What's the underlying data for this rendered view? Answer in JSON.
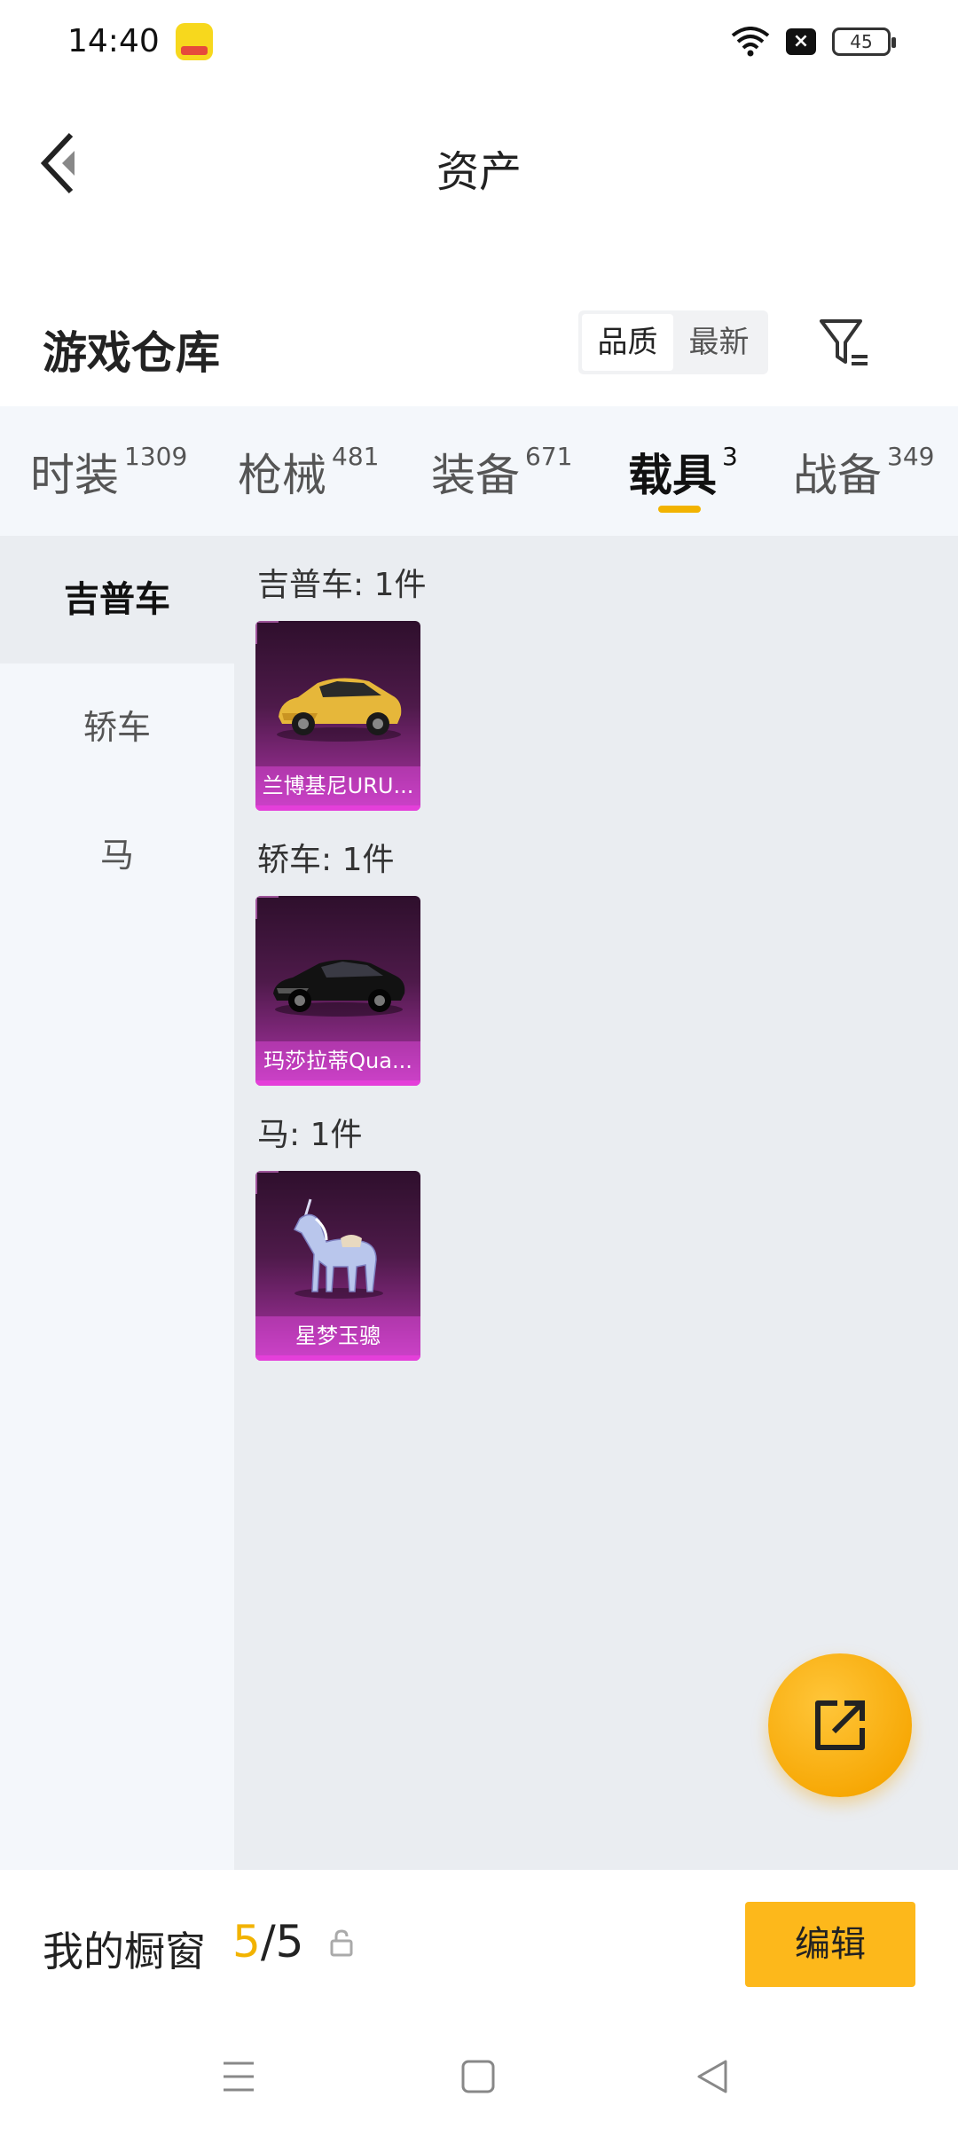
{
  "status_bar": {
    "time": "14:40",
    "battery": "45"
  },
  "header": {
    "title": "资产"
  },
  "warehouse": {
    "title": "游戏仓库",
    "sort_options": [
      "品质",
      "最新"
    ],
    "sort_selected": "品质"
  },
  "tabs": [
    {
      "label": "时装",
      "count": "1309"
    },
    {
      "label": "枪械",
      "count": "481"
    },
    {
      "label": "装备",
      "count": "671"
    },
    {
      "label": "载具",
      "count": "3",
      "active": true
    },
    {
      "label": "战备",
      "count": "349"
    }
  ],
  "side_categories": [
    {
      "label": "吉普车",
      "active": true
    },
    {
      "label": "轿车"
    },
    {
      "label": "马"
    }
  ],
  "sections": [
    {
      "label": "吉普车: 1件",
      "item_name": "兰博基尼URU...",
      "item_icon": "yellow-suv-icon"
    },
    {
      "label": "轿车: 1件",
      "item_name": "玛莎拉蒂Qua...",
      "item_icon": "black-sedan-icon"
    },
    {
      "label": "马: 1件",
      "item_name": "星梦玉骢",
      "item_icon": "unicorn-icon"
    }
  ],
  "showcase": {
    "label": "我的橱窗",
    "current": "5",
    "separator": "/",
    "total": "5",
    "edit_label": "编辑"
  },
  "colors": {
    "accent": "#f2b300",
    "button": "#fdb81b",
    "card_bg": "#4e1a4a"
  }
}
